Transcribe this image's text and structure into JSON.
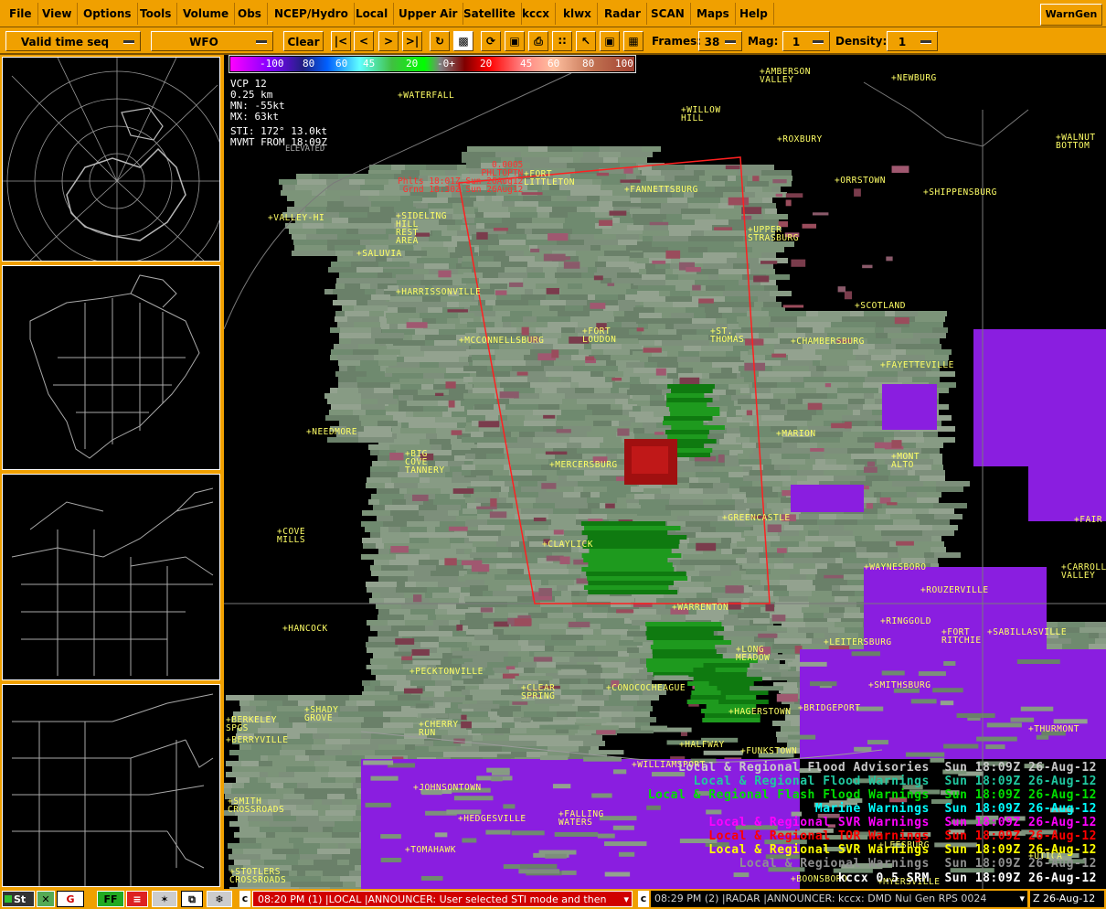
{
  "menu": [
    "File",
    "View",
    "Options",
    "Tools",
    "Volume",
    "Obs",
    "NCEP/Hydro",
    "Local",
    "Upper Air",
    "Satellite",
    "kccx",
    "klwx",
    "Radar",
    "SCAN",
    "Maps",
    "Help"
  ],
  "wamgen": "WarnGen",
  "toolbar": {
    "valid_time": "Valid time seq",
    "wfo": "WFO",
    "clear": "Clear",
    "frames_label": "Frames:",
    "frames_value": "38",
    "mag_label": "Mag:",
    "mag_value": "1",
    "density_label": "Density:",
    "density_value": "1"
  },
  "colorbar": {
    "labels": [
      "-100",
      "80",
      "60",
      "45",
      "20",
      "-0+",
      "20",
      "45",
      "60",
      "80",
      "100"
    ]
  },
  "radar_info": {
    "vcp": "VCP  12",
    "elev": "0.25  km",
    "mn": "MN:  -55kt",
    "mx": "MX:  63kt",
    "sti": "STI: 172°   13.0kt",
    "mvmt": "MVMT FROM  18:09Z",
    "elev_time": "ELEVATED",
    "plot1": "0.0005",
    "plot2": "PHLTOPTN",
    "plot3": "Phlts 18:01Z Sun 26Aug12",
    "plot4": "Grnd 18:30Z Sun 26Aug12"
  },
  "towns": [
    {
      "n": "WATERFALL"
    },
    {
      "n": "AMBERSON\nVALLEY"
    },
    {
      "n": "NEWBURG"
    },
    {
      "n": "WILLOW\nHILL"
    },
    {
      "n": "ROXBURY"
    },
    {
      "n": "WALNUT\nBOTTOM"
    },
    {
      "n": "FORT\nLITTLETON"
    },
    {
      "n": "FANNETTSBURG"
    },
    {
      "n": "ORRSTOWN"
    },
    {
      "n": "SHIPPENSBURG"
    },
    {
      "n": "VALLEY-HI"
    },
    {
      "n": "SIDELING\nHILL\nREST\nAREA"
    },
    {
      "n": "UPPER\nSTRASBURG"
    },
    {
      "n": "SALUVIA"
    },
    {
      "n": "HARRISSONVILLE"
    },
    {
      "n": "SCOTLAND"
    },
    {
      "n": "FORT\nLOUDON"
    },
    {
      "n": "ST.\nTHOMAS"
    },
    {
      "n": "MCCONNELLSBURG"
    },
    {
      "n": "CHAMBERSBURG"
    },
    {
      "n": "FAYETTEVILLE"
    },
    {
      "n": "NEEDMORE"
    },
    {
      "n": "MARION"
    },
    {
      "n": "BIG\nCOVE\nTANNERY"
    },
    {
      "n": "MERCERSBURG"
    },
    {
      "n": "MONT\nALTO"
    },
    {
      "n": "GREENCASTLE"
    },
    {
      "n": "COVE\nMILLS"
    },
    {
      "n": "CLAYLICK"
    },
    {
      "n": "FAIR"
    },
    {
      "n": "WAYNESBORO"
    },
    {
      "n": "CARROLL\nVALLEY"
    },
    {
      "n": "ROUZERVILLE"
    },
    {
      "n": "WARRENTON"
    },
    {
      "n": "RINGGOLD"
    },
    {
      "n": "HANCOCK"
    },
    {
      "n": "FORT\nRITCHIE"
    },
    {
      "n": "SABILLASVILLE"
    },
    {
      "n": "LEITERSBURG"
    },
    {
      "n": "LONG\nMEADOW"
    },
    {
      "n": "PECKTONVILLE"
    },
    {
      "n": "SMITHSBURG"
    },
    {
      "n": "CONOCOCHEAGUE"
    },
    {
      "n": "CLEAR\nSPRING"
    },
    {
      "n": "SHADY\nGROVE"
    },
    {
      "n": "BERKELEY\nSPGS"
    },
    {
      "n": "HAGERSTOWN"
    },
    {
      "n": "BRIDGEPORT"
    },
    {
      "n": "BERRYVILLE"
    },
    {
      "n": "CHERRY\nRUN"
    },
    {
      "n": "THURMONT"
    },
    {
      "n": "HALFWAY"
    },
    {
      "n": "FUNKSTOWN"
    },
    {
      "n": "JOHNSONTOWN"
    },
    {
      "n": "SMITH\nCROSSROADS"
    },
    {
      "n": "HEDGESVILLE"
    },
    {
      "n": "FALLING\nWATERS"
    },
    {
      "n": "TOMAHAWK"
    },
    {
      "n": "STOTLERS\nCROSSROADS"
    },
    {
      "n": "BOONSBORO"
    },
    {
      "n": "MYERSVILLE"
    },
    {
      "n": "UTICA"
    },
    {
      "n": "WILLIAMSPORT"
    },
    {
      "n": "LEESBURG"
    }
  ],
  "legend": [
    {
      "label": "Local & Regional Flood Advisories",
      "time": "Sun 18:09Z",
      "date": "26-Aug-12",
      "color": "#c8c8c8"
    },
    {
      "label": "Local & Regional Flood Warnings",
      "time": "Sun 18:09Z",
      "date": "26-Aug-12",
      "color": "#20c8a0"
    },
    {
      "label": "Local & Regional Flash Flood Warnings",
      "time": "Sun 18:09Z",
      "date": "26-Aug-12",
      "color": "#00e000"
    },
    {
      "label": "Marine Warnings",
      "time": "Sun 18:09Z",
      "date": "26-Aug-12",
      "color": "#00ffff"
    },
    {
      "label": "Local & Regional SVR Warnings",
      "time": "Sun 18:09Z",
      "date": "26-Aug-12",
      "color": "#ff00ff"
    },
    {
      "label": "Local & Regional TOR Warnings",
      "time": "Sun 18:09Z",
      "date": "26-Aug-12",
      "color": "#ff0000"
    },
    {
      "label": "Local & Regional SVR Warnings",
      "time": "Sun 18:09Z",
      "date": "26-Aug-12",
      "color": "#ffff00"
    },
    {
      "label": "Local & Regional Warnings",
      "time": "Sun 18:09Z",
      "date": "26-Aug-12",
      "color": "#909090"
    },
    {
      "label": "kccx 0.5 SRM",
      "time": "Sun 18:09Z",
      "date": "26-Aug-12",
      "color": "#ffffff"
    }
  ],
  "status": {
    "left_btn": "St",
    "ff": "FF",
    "msg1": "08:20 PM (1) |LOCAL |ANNOUNCER: User selected STI mode and then",
    "msg2": "08:29 PM (2) |RADAR |ANNOUNCER: kccx: DMD  Nul Gen RPS 0024",
    "clock": "Z 26-Aug-12"
  }
}
